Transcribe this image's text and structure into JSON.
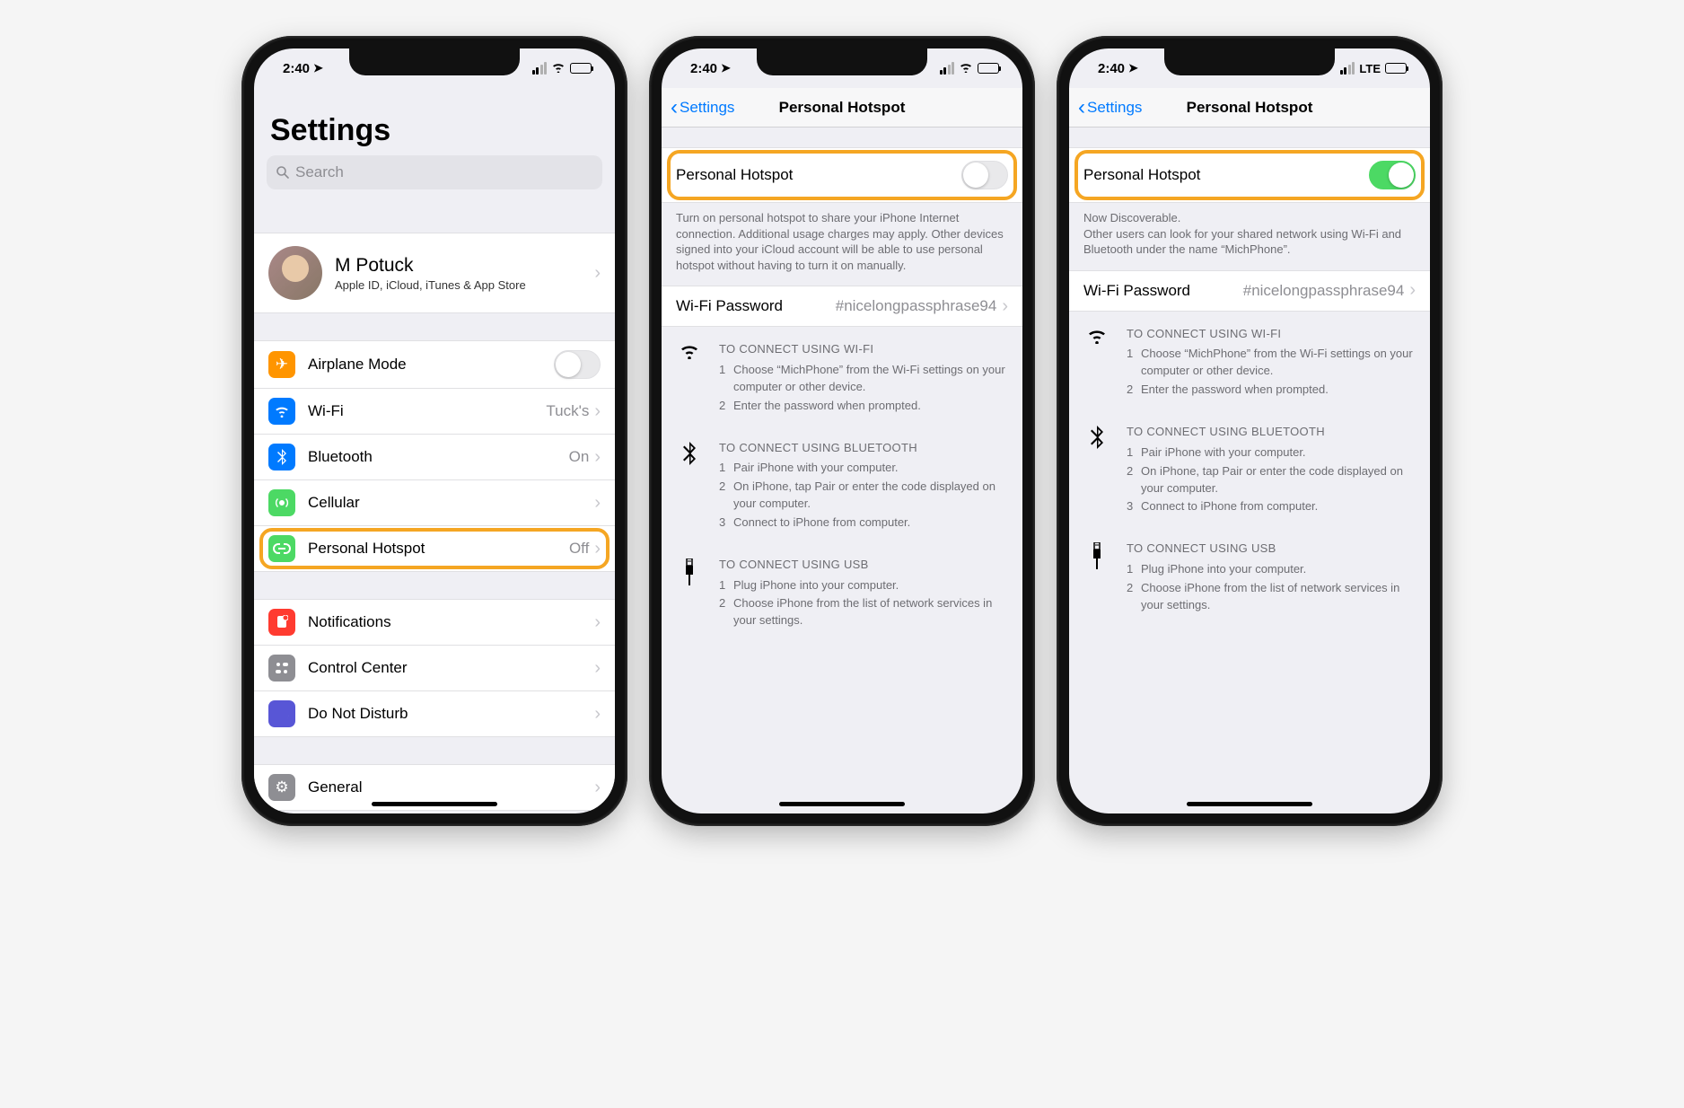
{
  "status": {
    "time": "2:40",
    "carrier_mode_lte": "LTE"
  },
  "screen1": {
    "title": "Settings",
    "search_placeholder": "Search",
    "profile": {
      "name": "M Potuck",
      "subtitle": "Apple ID, iCloud, iTunes & App Store"
    },
    "rows": {
      "airplane": "Airplane Mode",
      "wifi": "Wi-Fi",
      "wifi_value": "Tuck's",
      "bluetooth": "Bluetooth",
      "bluetooth_value": "On",
      "cellular": "Cellular",
      "hotspot": "Personal Hotspot",
      "hotspot_value": "Off",
      "notifications": "Notifications",
      "control_center": "Control Center",
      "dnd": "Do Not Disturb",
      "general": "General"
    }
  },
  "screen2": {
    "back": "Settings",
    "title": "Personal Hotspot",
    "toggle_label": "Personal Hotspot",
    "footer_off": "Turn on personal hotspot to share your iPhone Internet connection. Additional usage charges may apply. Other devices signed into your iCloud account will be able to use personal hotspot without having to turn it on manually.",
    "wifi_pwd_label": "Wi-Fi Password",
    "wifi_pwd_value": "#nicelongpassphrase94",
    "info": {
      "wifi_title": "TO CONNECT USING WI-FI",
      "wifi_1": "Choose “MichPhone” from the Wi-Fi settings on your computer or other device.",
      "wifi_2": "Enter the password when prompted.",
      "bt_title": "TO CONNECT USING BLUETOOTH",
      "bt_1": "Pair iPhone with your computer.",
      "bt_2": "On iPhone, tap Pair or enter the code displayed on your computer.",
      "bt_3": "Connect to iPhone from computer.",
      "usb_title": "TO CONNECT USING USB",
      "usb_1": "Plug iPhone into your computer.",
      "usb_2": "Choose iPhone from the list of network services in your settings."
    }
  },
  "screen3": {
    "back": "Settings",
    "title": "Personal Hotspot",
    "toggle_label": "Personal Hotspot",
    "footer_on_1": "Now Discoverable.",
    "footer_on_2": "Other users can look for your shared network using Wi-Fi and Bluetooth under the name “MichPhone”.",
    "wifi_pwd_label": "Wi-Fi Password",
    "wifi_pwd_value": "#nicelongpassphrase94"
  }
}
